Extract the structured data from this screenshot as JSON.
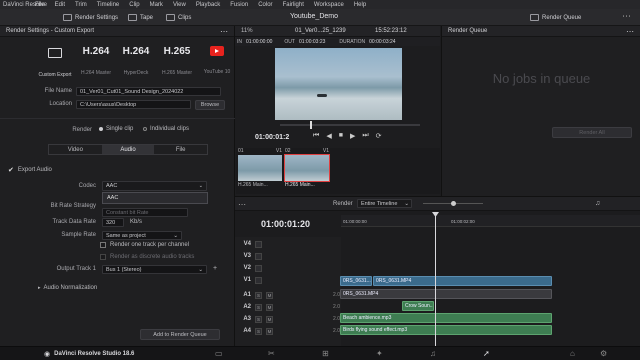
{
  "menubar": {
    "app": "DaVinci Resolve",
    "items": [
      "File",
      "Edit",
      "Trim",
      "Timeline",
      "Clip",
      "Mark",
      "View",
      "Playback",
      "Fusion",
      "Color",
      "Fairlight",
      "Workspace",
      "Help"
    ]
  },
  "toolbar": {
    "render_settings": "Render Settings",
    "tape": "Tape",
    "clips": "Clips",
    "project_title": "Youtube_Demo",
    "render_queue": "Render Queue"
  },
  "render_settings": {
    "title": "Render Settings - Custom Export",
    "presets": [
      {
        "big": "",
        "small": "Custom Export"
      },
      {
        "big": "H.264",
        "small": "H.264 Master"
      },
      {
        "big": "H.264",
        "small": "HyperDeck"
      },
      {
        "big": "H.265",
        "small": "H.265 Master"
      },
      {
        "big": "",
        "small": "YouTube 10"
      }
    ],
    "file_name_label": "File Name",
    "file_name_value": "01_Ver01_Cut01_Sound Design_2024022",
    "location_label": "Location",
    "location_value": "C:\\Users\\asus\\Desktop",
    "browse": "Browse",
    "render_label": "Render",
    "single_clip": "Single clip",
    "individual_clips": "Individual clips",
    "tabs": [
      "Video",
      "Audio",
      "File"
    ],
    "export_audio": "Export Audio",
    "codec_label": "Codec",
    "codec_value": "AAC",
    "codec_option": "AAC",
    "bit_rate_label": "Bit Rate Strategy",
    "bit_rate_value": "Constant bit Rate",
    "track_data_rate_label": "Track Data Rate",
    "track_data_rate_value": "320",
    "track_data_rate_unit": "Kb/s",
    "sample_rate_label": "Sample Rate",
    "sample_rate_value": "Same as project",
    "one_track_per_channel": "Render one track per channel",
    "discrete_audio": "Render as discrete audio tracks",
    "output_track_label": "Output Track 1",
    "output_track_value": "Bus 1 (Stereo)",
    "audio_normalization": "Audio Normalization",
    "add_to_queue": "Add to Render Queue"
  },
  "viewer": {
    "zoom": "11%",
    "clip_name": "01_Ver0...25_1239",
    "timecode_top": "15:52:23:12",
    "in_label": "IN",
    "in_value": "01:00:00:00",
    "out_label": "OUT",
    "out_value": "01:00:03:23",
    "duration_label": "DURATION",
    "duration_value": "00:00:03:24",
    "current_tc": "01:00:01:2"
  },
  "queue": {
    "title": "Render Queue",
    "empty": "No jobs in queue",
    "render_all": "Render All"
  },
  "thumbnails": [
    {
      "index": "01",
      "track": "V1",
      "name": "H.265 Main..."
    },
    {
      "index": "02",
      "track": "V1",
      "name": "H.265 Main..."
    }
  ],
  "timeline": {
    "render_label": "Render",
    "render_mode": "Entire Timeline",
    "timecode": "01:00:01:20",
    "ruler": [
      "01:00:00:00",
      "01:00:02:00"
    ],
    "tracks": [
      {
        "name": "V4"
      },
      {
        "name": "V3"
      },
      {
        "name": "V2"
      },
      {
        "name": "V1"
      },
      {
        "name": "A1",
        "level": "2.0"
      },
      {
        "name": "A2",
        "level": "2.0"
      },
      {
        "name": "A3",
        "level": "2.0"
      },
      {
        "name": "A4",
        "level": "2.0"
      }
    ],
    "clips": {
      "v1a": "0RS_0631...",
      "v1b": "0RS_0631.MP4",
      "a1": "0RS_0631.MP4",
      "a2": "Crow Soun...",
      "a3": "Beach ambience.mp3",
      "a4": "Birds flying sound effect.mp3"
    }
  },
  "bottom": {
    "brand": "DaVinci Resolve Studio 18.6"
  }
}
